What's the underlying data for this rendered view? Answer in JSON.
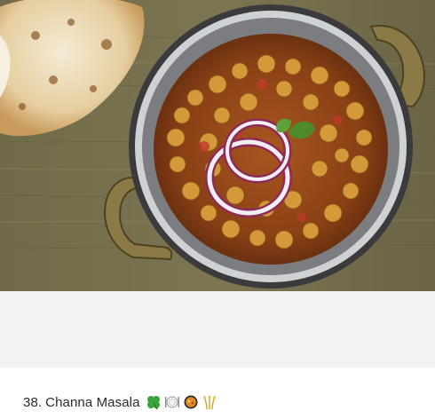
{
  "post": {
    "image_alt": "Channa Masala in a steel kadai with onion rings and naan",
    "caption_number": "38.",
    "caption_title": "Channa Masala",
    "emojis": [
      "four-leaf-clover",
      "plate-with-cutlery",
      "shallow-pan-of-food",
      "sheaf-of-rice"
    ]
  }
}
